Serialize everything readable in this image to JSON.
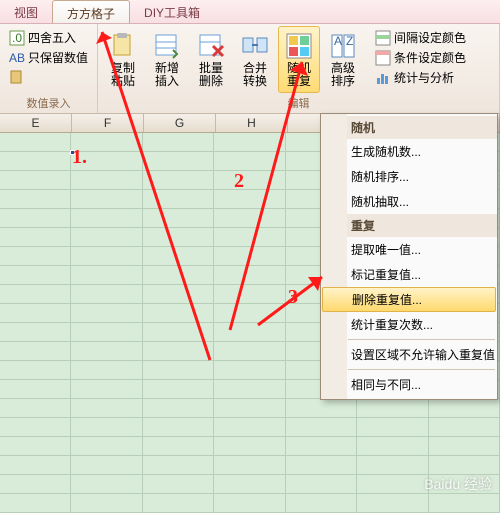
{
  "tabs": {
    "view": "视图",
    "fangfang": "方方格子",
    "diy": "DIY工具箱"
  },
  "ribbon": {
    "group1": {
      "label": "数值录入",
      "round": "四舍五入",
      "keep": "只保留数值"
    },
    "group2": {
      "label": "编辑",
      "copy": "复制\n粘贴",
      "insert": "新增\n插入",
      "del": "批量\n删除",
      "merge": "合并\n转换",
      "random": "随机\n重复",
      "sort": "高级\n排序",
      "color1": "间隔设定颜色",
      "color2": "条件设定颜色",
      "stats": "统计与分析"
    }
  },
  "columns": [
    "E",
    "F",
    "G",
    "H"
  ],
  "rowcount": 20,
  "menu": {
    "hdr1": "随机",
    "gen": "生成随机数...",
    "rsort": "随机排序...",
    "rpick": "随机抽取...",
    "hdr2": "重复",
    "unique": "提取唯一值...",
    "mark": "标记重复值...",
    "deldup": "删除重复值...",
    "count": "统计重复次数...",
    "restrict": "设置区域不允许输入重复值",
    "diff": "相同与不同..."
  },
  "annotations": {
    "a1": "1.",
    "a2": "2",
    "a3": "3"
  },
  "watermark": "Baidu 经验"
}
